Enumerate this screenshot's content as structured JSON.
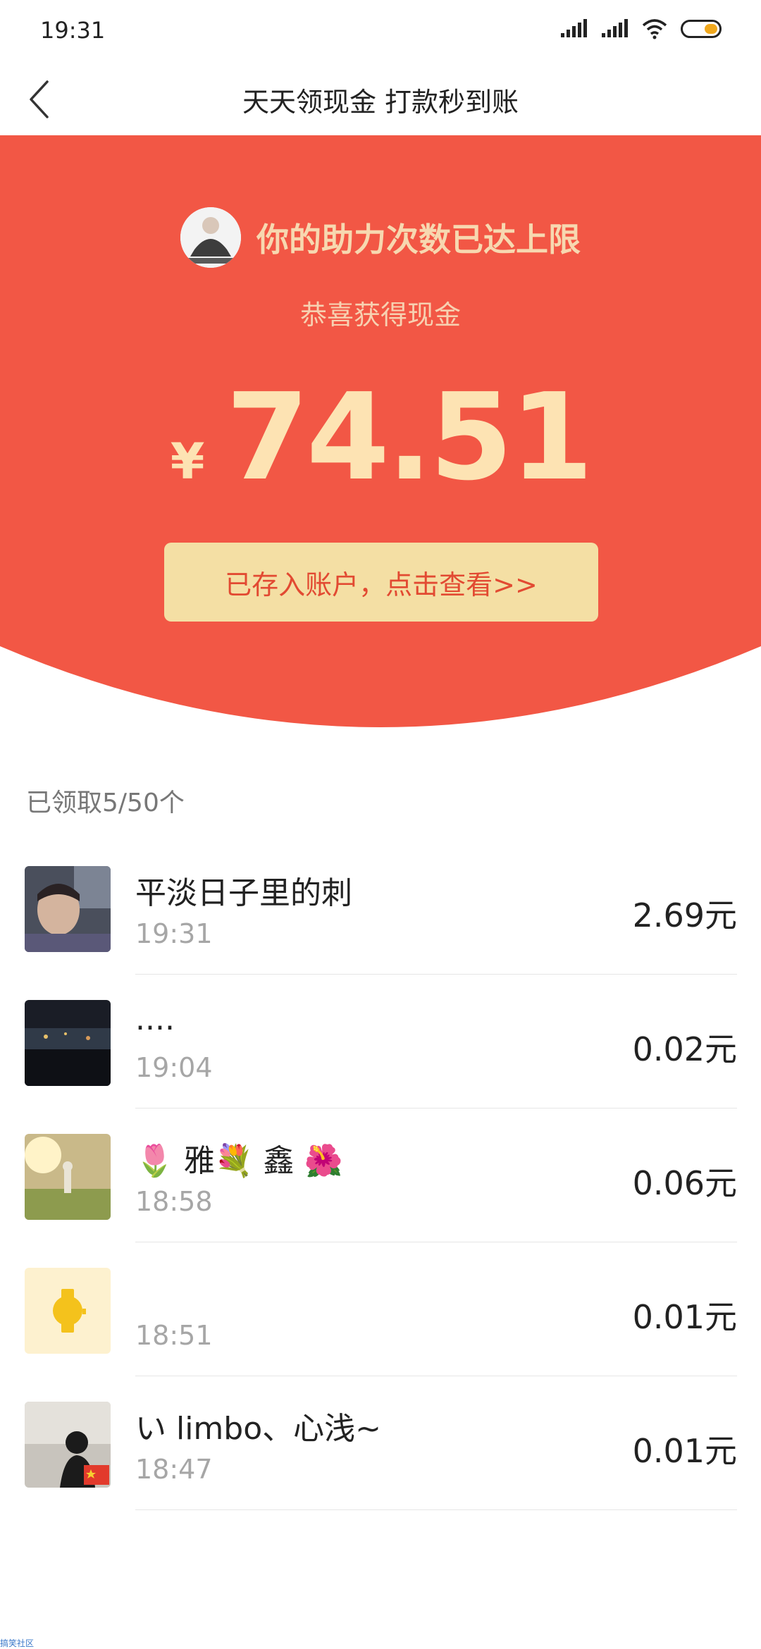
{
  "status_bar": {
    "time": "19:31"
  },
  "nav": {
    "title": "天天领现金 打款秒到账"
  },
  "hero": {
    "limit_text": "你的助力次数已达上限",
    "congrats_text": "恭喜获得现金",
    "currency_symbol": "¥",
    "amount": "74.51",
    "deposit_button_label": "已存入账户，点击查看>>",
    "background_color": "#f25745",
    "accent_color": "#fde3b3"
  },
  "claimed": {
    "count_text": "已领取5/50个"
  },
  "list": {
    "items": [
      {
        "name": "平淡日子里的刺",
        "time": "19:31",
        "amount": "2.69元"
      },
      {
        "name": "....",
        "time": "19:04",
        "amount": "0.02元"
      },
      {
        "name": "🌷 雅💐 鑫 🌺",
        "time": "18:58",
        "amount": "0.06元"
      },
      {
        "name": "",
        "time": "18:51",
        "amount": "0.01元"
      },
      {
        "name": "い limbo、心浅~",
        "time": "18:47",
        "amount": "0.01元"
      }
    ]
  },
  "watermark": "搞笑社区"
}
